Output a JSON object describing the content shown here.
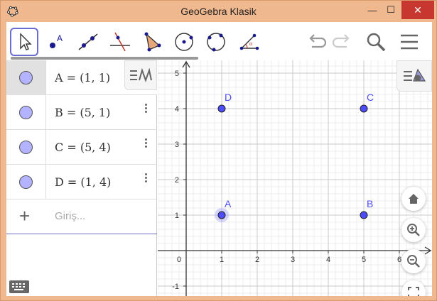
{
  "window": {
    "title": "GeoGebra Klasik",
    "min_label": "—",
    "max_label": "☐",
    "close_label": "✕"
  },
  "toolbar": {
    "tools": [
      {
        "name": "move-tool",
        "active": true
      },
      {
        "name": "point-tool",
        "active": false
      },
      {
        "name": "line-tool",
        "active": false
      },
      {
        "name": "perpendicular-line-tool",
        "active": false
      },
      {
        "name": "polygon-tool",
        "active": false
      },
      {
        "name": "circle-center-point-tool",
        "active": false
      },
      {
        "name": "circle-three-points-tool",
        "active": false
      },
      {
        "name": "angle-tool",
        "active": false
      }
    ],
    "right_icons": [
      "undo-icon",
      "redo-icon",
      "search-icon",
      "menu-icon"
    ]
  },
  "algebra": {
    "rows": [
      {
        "text": "A = (1, 1)",
        "selected": true
      },
      {
        "text": "B = (5, 1)",
        "selected": false
      },
      {
        "text": "C = (5, 4)",
        "selected": false
      },
      {
        "text": "D = (1, 4)",
        "selected": false
      }
    ],
    "input_placeholder": "Giriş...",
    "input_plus": "+"
  },
  "graphics": {
    "x_ticks": [
      "0",
      "1",
      "2",
      "3",
      "4",
      "5",
      "6"
    ],
    "y_ticks": [
      "-1",
      "1",
      "2",
      "3",
      "4",
      "5"
    ],
    "points": [
      {
        "label": "A",
        "x": 1,
        "y": 1,
        "selected": true
      },
      {
        "label": "B",
        "x": 5,
        "y": 1,
        "selected": false
      },
      {
        "label": "C",
        "x": 5,
        "y": 4,
        "selected": false
      },
      {
        "label": "D",
        "x": 1,
        "y": 4,
        "selected": false
      }
    ],
    "point_color": "#4d4dff",
    "label_color": "#4d4dff",
    "buttons": [
      "home-icon",
      "zoom-in-icon",
      "zoom-out-icon",
      "fullscreen-icon"
    ]
  },
  "colors": {
    "title_bar": "#f0b88e",
    "close_button": "#c7372f",
    "active_tool_border": "#6b6bd6",
    "point_fill": "#b3b3ff"
  }
}
